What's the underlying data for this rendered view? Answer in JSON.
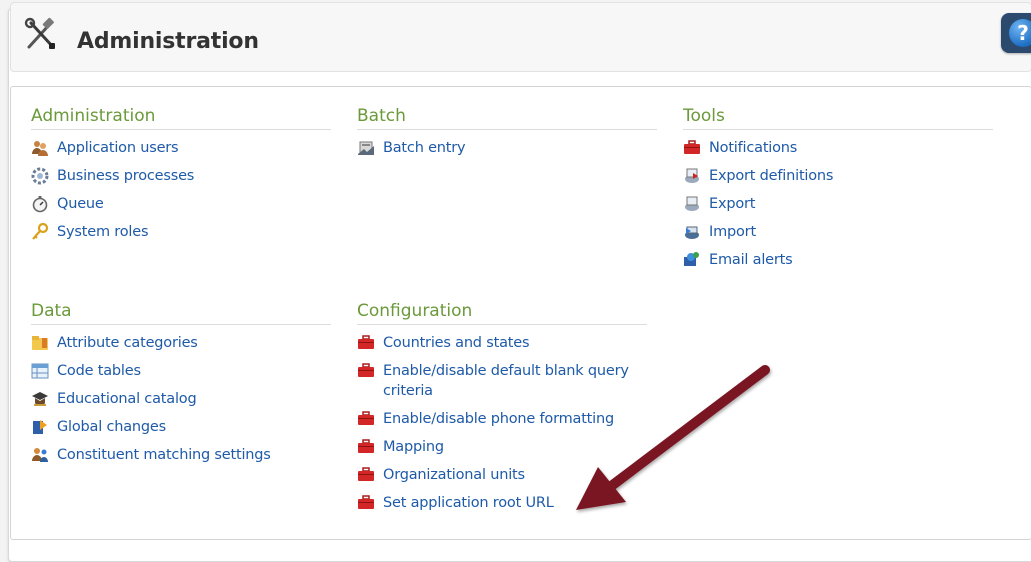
{
  "header": {
    "title": "Administration",
    "icon": "tools-icon",
    "help_icon": "help-icon",
    "help_label": "?"
  },
  "sections": {
    "administration": {
      "heading": "Administration",
      "items": [
        {
          "label": "Application users",
          "icon": "users-icon"
        },
        {
          "label": "Business processes",
          "icon": "gear-icon"
        },
        {
          "label": "Queue",
          "icon": "stopwatch-icon"
        },
        {
          "label": "System roles",
          "icon": "key-icon"
        }
      ]
    },
    "batch": {
      "heading": "Batch",
      "items": [
        {
          "label": "Batch entry",
          "icon": "batch-icon"
        }
      ]
    },
    "tools": {
      "heading": "Tools",
      "items": [
        {
          "label": "Notifications",
          "icon": "toolbox-icon"
        },
        {
          "label": "Export definitions",
          "icon": "export-definitions-icon"
        },
        {
          "label": "Export",
          "icon": "export-icon"
        },
        {
          "label": "Import",
          "icon": "import-icon"
        },
        {
          "label": "Email alerts",
          "icon": "email-alert-icon"
        }
      ]
    },
    "data": {
      "heading": "Data",
      "items": [
        {
          "label": "Attribute categories",
          "icon": "folder-icon"
        },
        {
          "label": "Code tables",
          "icon": "table-icon"
        },
        {
          "label": "Educational catalog",
          "icon": "graduation-cap-icon"
        },
        {
          "label": "Global changes",
          "icon": "global-changes-icon"
        },
        {
          "label": "Constituent matching settings",
          "icon": "constituent-match-icon"
        }
      ]
    },
    "configuration": {
      "heading": "Configuration",
      "items": [
        {
          "label": "Countries and states",
          "icon": "toolbox-icon"
        },
        {
          "label": "Enable/disable default blank query criteria",
          "icon": "toolbox-icon"
        },
        {
          "label": "Enable/disable phone formatting",
          "icon": "toolbox-icon"
        },
        {
          "label": "Mapping",
          "icon": "toolbox-icon"
        },
        {
          "label": "Organizational units",
          "icon": "toolbox-icon"
        },
        {
          "label": "Set application root URL",
          "icon": "toolbox-icon"
        }
      ]
    }
  },
  "annotation": {
    "color": "#7a1424",
    "icon": "callout-arrow"
  }
}
